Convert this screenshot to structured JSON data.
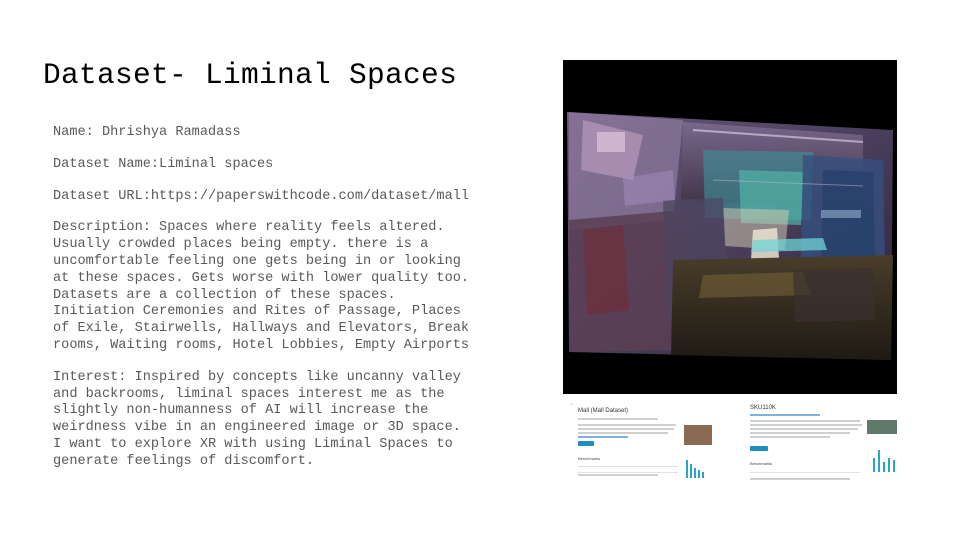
{
  "slide": {
    "title": "Dataset- Liminal Spaces",
    "name_line": "Name: Dhrishya Ramadass",
    "dataset_name_line": "Dataset Name:Liminal spaces",
    "dataset_url_line": "Dataset URL:https://paperswithcode.com/dataset/mall",
    "description": "Description: Spaces where reality feels altered.\nUsually crowded places being empty. there is a\nuncomfortable feeling one gets being in or looking\nat these spaces. Gets worse with lower quality too.\nDatasets are a collection of these spaces.\nInitiation Ceremonies and Rites of Passage, Places\nof Exile, Stairwells, Hallways and Elevators, Break\nrooms, Waiting rooms, Hotel Lobbies, Empty Airports",
    "interest": "Interest: Inspired by concepts like uncanny valley\nand backrooms, liminal spaces interest me as the\nslightly non-humanness of AI will increase the\nweirdness vibe in an engineered image or 3D space.\nI want to explore XR with using Liminal Spaces to\ngenerate feelings of discomfort."
  },
  "thumbnails": {
    "left": {
      "title": "Mall (Mall Dataset)",
      "section": "Benchmarks"
    },
    "right": {
      "title": "SKU110K",
      "section": "Benchmarks"
    }
  },
  "colors": {
    "title_text": "#000000",
    "body_text": "#595959",
    "accent_blue": "#1f8dbf"
  }
}
